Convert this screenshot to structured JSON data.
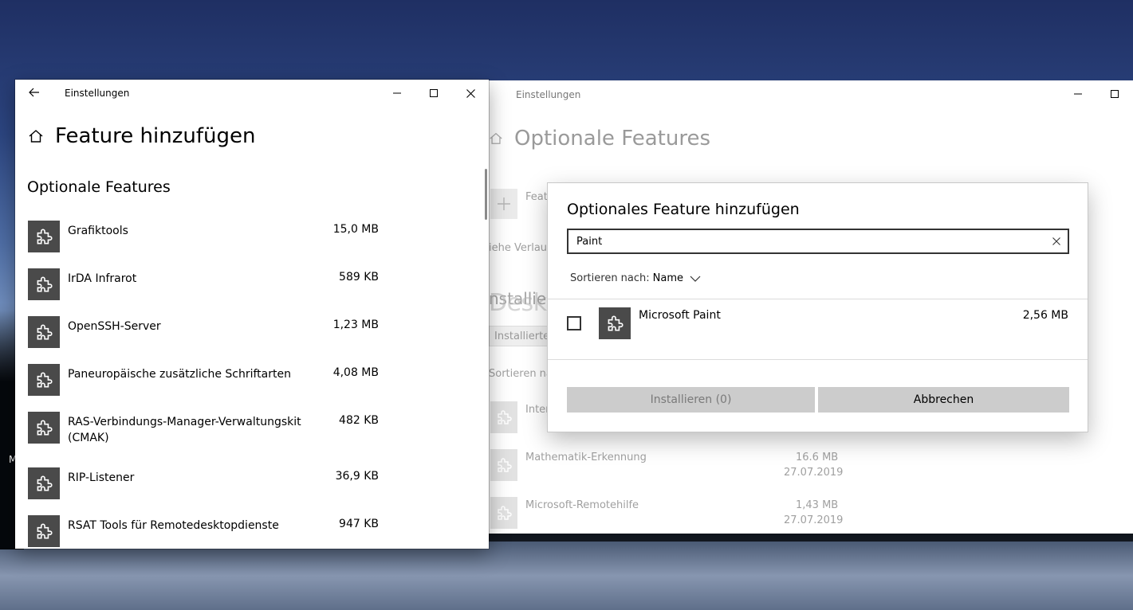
{
  "front": {
    "window_title": "Einstellungen",
    "page_title": "Feature hinzufügen",
    "section_title": "Optionale Features",
    "features": [
      {
        "name": "Grafiktools",
        "size": "15,0 MB"
      },
      {
        "name": "IrDA Infrarot",
        "size": "589 KB"
      },
      {
        "name": "OpenSSH-Server",
        "size": "1,23 MB"
      },
      {
        "name": "Paneuropäische zusätzliche Schriftarten",
        "size": "4,08 MB"
      },
      {
        "name": "RAS-Verbindungs-Manager-Verwaltungskit (CMAK)",
        "size": "482 KB"
      },
      {
        "name": "RIP-Listener",
        "size": "36,9 KB"
      },
      {
        "name": "RSAT Tools für Remotedesktopdienste",
        "size": "947 KB"
      }
    ]
  },
  "back": {
    "window_title": "Einstellungen",
    "page_title": "Optionale Features",
    "add_label": "Featu",
    "history_label": "iehe Verlauf",
    "installed_heading": "nstallierte",
    "installed_button": "Installierte",
    "sort_label": "Sortieren na",
    "watermark": "Deskmodder.de",
    "items": [
      {
        "name": "Inter",
        "size": "",
        "date": ""
      },
      {
        "name": "Mathematik-Erkennung",
        "size": "16.6 MB",
        "date": "27.07.2019"
      },
      {
        "name": "Microsoft-Remotehilfe",
        "size": "1,43 MB",
        "date": "27.07.2019"
      }
    ]
  },
  "dialog": {
    "title": "Optionales Feature hinzufügen",
    "search_value": "Paint",
    "sort_label": "Sortieren nach:",
    "sort_value": "Name",
    "result": {
      "name": "Microsoft Paint",
      "size": "2,56 MB"
    },
    "install_button": "Installieren (0)",
    "cancel_button": "Abbrechen"
  },
  "desktop": {
    "edge_letter": "M"
  },
  "colors": {
    "icon_bg": "#4a4a4a",
    "button_bg": "#cccccc",
    "disabled_text": "#7a7a7a"
  }
}
